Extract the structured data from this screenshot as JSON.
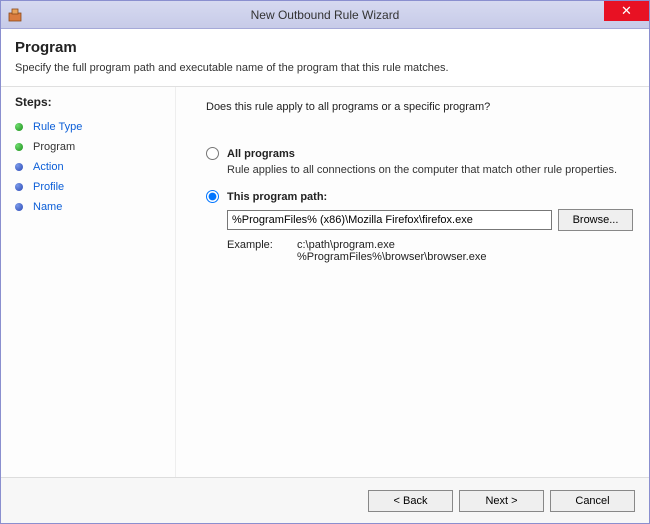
{
  "window": {
    "title": "New Outbound Rule Wizard",
    "close_glyph": "✕"
  },
  "header": {
    "title": "Program",
    "subtitle": "Specify the full program path and executable name of the program that this rule matches."
  },
  "sidebar": {
    "title": "Steps:",
    "items": [
      {
        "label": "Rule Type",
        "state": "completed"
      },
      {
        "label": "Program",
        "state": "current"
      },
      {
        "label": "Action",
        "state": "upcoming"
      },
      {
        "label": "Profile",
        "state": "upcoming"
      },
      {
        "label": "Name",
        "state": "upcoming"
      }
    ]
  },
  "main": {
    "prompt": "Does this rule apply to all programs or a specific program?",
    "option_all": {
      "label": "All programs",
      "desc": "Rule applies to all connections on the computer that match other rule properties.",
      "selected": false
    },
    "option_path": {
      "label": "This program path:",
      "selected": true,
      "value": "%ProgramFiles% (x86)\\Mozilla Firefox\\firefox.exe",
      "browse_label": "Browse...",
      "example_label": "Example:",
      "example1": "c:\\path\\program.exe",
      "example2": "%ProgramFiles%\\browser\\browser.exe"
    }
  },
  "footer": {
    "back": "< Back",
    "next": "Next >",
    "cancel": "Cancel"
  }
}
